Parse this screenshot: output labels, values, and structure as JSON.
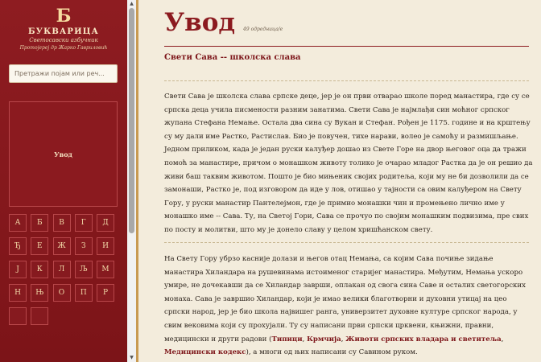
{
  "sidebar": {
    "brand_letter": "Б",
    "brand_title": "БУКВАРИЦА",
    "brand_subtitle": "Светосавски азбучник",
    "brand_author": "Протојереј др Жарко Гавриловић",
    "search_placeholder": "Претражи појам или реч...",
    "toc_item": "Увод",
    "letters": [
      "А",
      "Б",
      "В",
      "Г",
      "Д",
      "Ђ",
      "Е",
      "Ж",
      "З",
      "И",
      "Ј",
      "К",
      "Л",
      "Љ",
      "М",
      "Н",
      "Њ",
      "О",
      "П",
      "Р",
      "",
      ""
    ]
  },
  "main": {
    "title": "Увод",
    "entry_count": "49 одредница/е",
    "section_heading": "Свети Сава -- школска слава",
    "paragraph1": "Свети Сава је школска слава српске деце, јер је он први отварао школе поред манастира, где су се српска деца учила писмености разним занатима. Свети Сава је најмлађи син моћног српског жупана Стефана Немање. Остала два сина су Вукан и Стефан. Рођен је 1175. године и на крштењу су му дали име Растко, Растислав. Био је повучен, тихе нарави, волео је самоћу и размишљање. Једном приликом, када је један руски калуђер дошао из Свете Горе на двор његовог оца да тражи помоћ за манастире, причом о монашком животу толико је очарао младог Растка да је он решио да живи баш таквим животом. Пошто је био мињеник својих родитеља, који му не би дозволили да се замонаши, Растко је, под изговором да иде у лов, отишао у тајности са овим калуђером на Свету Гору, у руски манастир Пантелејмон, где је примио монашки чин и промењено лично име у монашко име -- Сава. Ту, на Светој Гори, Сава се прочуо по својим монашким подвизима, пре свих по посту и молитви, што му је донело славу у целом хришћанском свету.",
    "paragraph2_start": "На Свету Гору убрзо касније долази и његов отац Немања, са којим Сава почиње зидање манастира Хиландара на рушевинама истоименог старијег манастира. Међутим, Немања ускоро умире, не дочекавши да се Хиландар заврши, оплакан од свога сина Саве и осталих светогорских монаха. Сава је завршио Хиландар, који је имао велики благотворни и духовни утицај на цео српски народ, јер је био школа највишег ранга, универзитет духовне културе српског народа, у свим вековима који су прохујали. Ту су написани први српски црквени, књижни, правни, медицински и други радови (",
    "works": [
      "Типици",
      "Крмчија",
      "Животи српских владара и светитеља",
      "Медицински кодекс"
    ],
    "paragraph2_end": "), а многи од њих написани су Савином руком."
  },
  "colors": {
    "accent_red": "#8b1a1f",
    "gold": "#c89a52",
    "paper": "#f3ecdc"
  }
}
